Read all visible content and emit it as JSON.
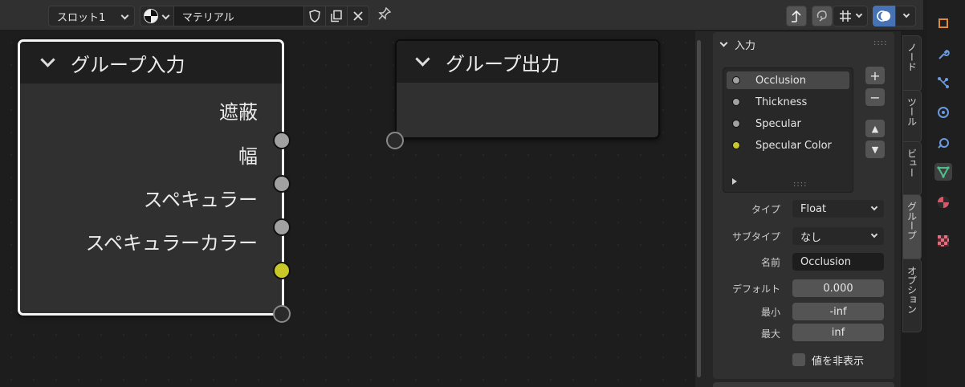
{
  "header": {
    "slot_label": "スロット1",
    "material_name": "マテリアル",
    "fake_user_icon": "shield-icon",
    "duplicate_icon": "duplicate-icon",
    "unlink_icon": "close-icon",
    "pin_icon": "pin-icon",
    "right_icons": [
      "parent-node-tree-icon",
      "backdrop-icon",
      "snap-grid-icon",
      "overlay-icon"
    ]
  },
  "node_in": {
    "title": "グループ入力",
    "outputs": [
      {
        "label": "遮蔽",
        "color": "#a1a1a1"
      },
      {
        "label": "幅",
        "color": "#a1a1a1"
      },
      {
        "label": "スペキュラー",
        "color": "#a1a1a1"
      },
      {
        "label": "スペキュラーカラー",
        "color": "#c8c829"
      }
    ]
  },
  "node_out": {
    "title": "グループ出力"
  },
  "panel": {
    "title": "入力",
    "items": [
      {
        "label": "Occlusion",
        "active": true,
        "color": "#a1a1a1"
      },
      {
        "label": "Thickness",
        "active": false,
        "color": "#a1a1a1"
      },
      {
        "label": "Specular",
        "active": false,
        "color": "#a1a1a1"
      },
      {
        "label": "Specular Color",
        "active": false,
        "color": "#c8c829"
      }
    ],
    "add_label": "+",
    "remove_label": "−",
    "move_up_label": "▲",
    "move_down_label": "▼",
    "type_label": "タイプ",
    "type_value": "Float",
    "subtype_label": "サブタイプ",
    "subtype_value": "なし",
    "name_label": "名前",
    "name_value": "Occlusion",
    "default_label": "デフォルト",
    "default_value": "0.000",
    "min_label": "最小",
    "min_value": "-inf",
    "max_label": "最大",
    "max_value": "inf",
    "hide_value_label": "値を非表示"
  },
  "tabs": [
    "ノード",
    "ツール",
    "ビュー",
    "グループ",
    "オプション"
  ],
  "active_tab": "グループ",
  "accent_color": "#4772b3"
}
